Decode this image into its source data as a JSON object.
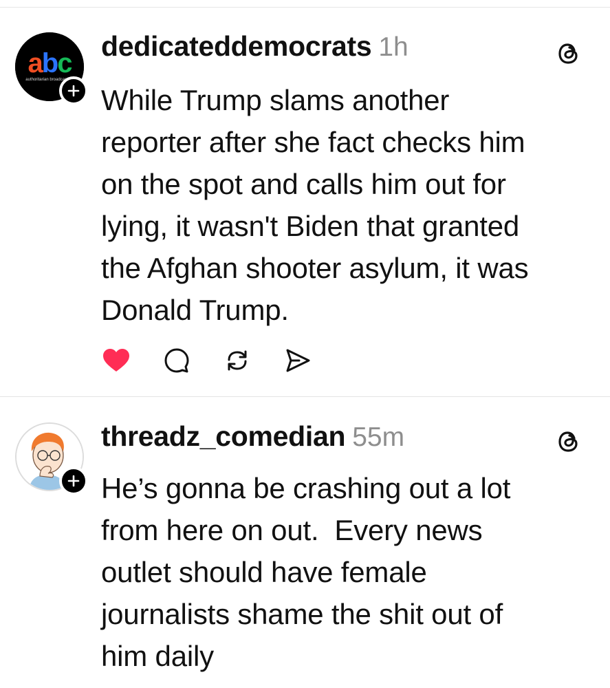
{
  "posts": [
    {
      "username": "dedicateddemocrats",
      "timestamp": "1h",
      "avatar_logo_text": "abc",
      "avatar_logo_subtext": "authoritarian broadcasting",
      "text": "While Trump slams another\nreporter after she fact checks him\non the spot and calls him out for\nlying, it wasn't Biden that granted\nthe Afghan shooter asylum, it was\nDonald Trump.",
      "liked": true,
      "actions": [
        "heart-icon",
        "comment-icon",
        "repost-icon",
        "share-icon"
      ]
    },
    {
      "username": "threadz_comedian",
      "timestamp": "55m",
      "text": "He’s gonna be crashing out a lot\nfrom here on out.  Every news\noutlet should have female\njournalists shame the shit out of\nhim daily"
    }
  ],
  "colors": {
    "like_red": "#ff2d55",
    "timestamp_gray": "#8e8e8e",
    "text": "#111111",
    "divider": "#e3e3e3"
  }
}
